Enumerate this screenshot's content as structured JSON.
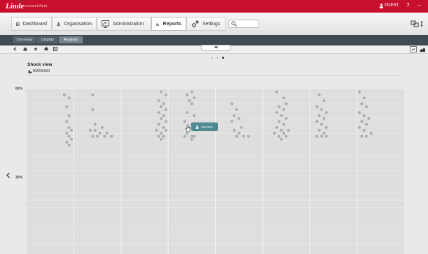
{
  "app": {
    "logo_text": "Linde",
    "logo_sub": "connect:fleet",
    "user_name": "PGERT",
    "window_controls": "? –"
  },
  "nav": {
    "tabs": [
      {
        "label": "Dashboard",
        "icon": "grid-icon"
      },
      {
        "label": "Organisation",
        "icon": "org-chart-icon"
      },
      {
        "label": "Administration",
        "icon": "admin-screen-icon"
      },
      {
        "label": "Reports",
        "icon": "bar-chart-icon",
        "active": true
      },
      {
        "label": "Settings",
        "icon": "gears-icon"
      }
    ],
    "search_placeholder": ""
  },
  "breadcrumb": [
    "Overview",
    "Display",
    "Analysis"
  ],
  "pager": {
    "count": 3,
    "active_index": 2
  },
  "panel": {
    "title": "Shock view",
    "subtitle": "BM295660"
  },
  "chart_data": {
    "type": "scatter",
    "title": "",
    "xlabel": "",
    "ylabel": "",
    "y_tick_labels": [
      "60%",
      "30%"
    ],
    "grid": true,
    "columns": 8,
    "series": [
      {
        "name": "",
        "color": "#a9aeb3",
        "points": [
          [
            1.6,
            58
          ],
          [
            1.8,
            57
          ],
          [
            1.7,
            54
          ],
          [
            1.8,
            51
          ],
          [
            1.7,
            49
          ],
          [
            1.8,
            47
          ],
          [
            1.9,
            46
          ],
          [
            1.7,
            45
          ],
          [
            1.8,
            44
          ],
          [
            1.9,
            43
          ],
          [
            1.7,
            42
          ],
          [
            1.8,
            41
          ],
          [
            2.8,
            58
          ],
          [
            2.8,
            53
          ],
          [
            2.9,
            48
          ],
          [
            3.2,
            47
          ],
          [
            2.7,
            46
          ],
          [
            2.9,
            46
          ],
          [
            3.1,
            45
          ],
          [
            3.4,
            45
          ],
          [
            2.8,
            44
          ],
          [
            3.0,
            44
          ],
          [
            3.3,
            44
          ],
          [
            3.6,
            44
          ],
          [
            5.7,
            59
          ],
          [
            5.9,
            58
          ],
          [
            5.6,
            56
          ],
          [
            5.8,
            55
          ],
          [
            5.7,
            54
          ],
          [
            5.9,
            53
          ],
          [
            5.6,
            52
          ],
          [
            5.8,
            51
          ],
          [
            5.7,
            50
          ],
          [
            5.9,
            49
          ],
          [
            5.6,
            48
          ],
          [
            5.8,
            47
          ],
          [
            5.5,
            46
          ],
          [
            5.9,
            46
          ],
          [
            5.7,
            45
          ],
          [
            5.6,
            44
          ],
          [
            5.8,
            44
          ],
          [
            5.7,
            43
          ],
          [
            7.0,
            59
          ],
          [
            6.8,
            58
          ],
          [
            7.1,
            57
          ],
          [
            6.9,
            56
          ],
          [
            7.0,
            55
          ],
          [
            6.8,
            52
          ],
          [
            7.1,
            51
          ],
          [
            6.7,
            49
          ],
          [
            7.0,
            48
          ],
          [
            6.9,
            47
          ],
          [
            7.2,
            46
          ],
          [
            6.8,
            45
          ],
          [
            7.0,
            44
          ],
          [
            7.1,
            44
          ],
          [
            6.7,
            44
          ],
          [
            7.0,
            43
          ],
          [
            8.7,
            55
          ],
          [
            8.9,
            53
          ],
          [
            8.8,
            51
          ],
          [
            9.0,
            50
          ],
          [
            8.7,
            49
          ],
          [
            9.1,
            47
          ],
          [
            8.8,
            46
          ],
          [
            9.0,
            45
          ],
          [
            9.2,
            44
          ],
          [
            8.9,
            44
          ],
          [
            9.4,
            44
          ],
          [
            10.6,
            59
          ],
          [
            10.9,
            57
          ],
          [
            11.0,
            55
          ],
          [
            10.7,
            54
          ],
          [
            10.9,
            53
          ],
          [
            10.6,
            52
          ],
          [
            10.8,
            51
          ],
          [
            11.0,
            50
          ],
          [
            10.7,
            49
          ],
          [
            10.9,
            48
          ],
          [
            10.6,
            47
          ],
          [
            10.8,
            46
          ],
          [
            11.1,
            46
          ],
          [
            10.5,
            45
          ],
          [
            10.9,
            45
          ],
          [
            10.7,
            44
          ],
          [
            11.0,
            44
          ],
          [
            10.8,
            43
          ],
          [
            12.4,
            58
          ],
          [
            12.6,
            56
          ],
          [
            12.3,
            54
          ],
          [
            12.5,
            53
          ],
          [
            12.7,
            52
          ],
          [
            12.4,
            51
          ],
          [
            12.6,
            50
          ],
          [
            12.3,
            49
          ],
          [
            12.5,
            48
          ],
          [
            12.7,
            47
          ],
          [
            12.4,
            46
          ],
          [
            12.6,
            45
          ],
          [
            12.5,
            44
          ],
          [
            12.7,
            44
          ],
          [
            12.3,
            44
          ],
          [
            14.1,
            59
          ],
          [
            14.3,
            57
          ],
          [
            14.2,
            55
          ],
          [
            14.4,
            54
          ],
          [
            14.1,
            52
          ],
          [
            14.3,
            51
          ],
          [
            14.5,
            50
          ],
          [
            14.2,
            49
          ],
          [
            14.4,
            48
          ],
          [
            14.1,
            47
          ],
          [
            14.3,
            46
          ],
          [
            14.6,
            45
          ],
          [
            14.2,
            44
          ],
          [
            14.4,
            44
          ]
        ]
      }
    ]
  },
  "tooltip": {
    "text": "101 kPa"
  },
  "colors": {
    "brand": "#c8102e",
    "tooltip": "#4f8a91",
    "dot": "#a9aeb3"
  }
}
